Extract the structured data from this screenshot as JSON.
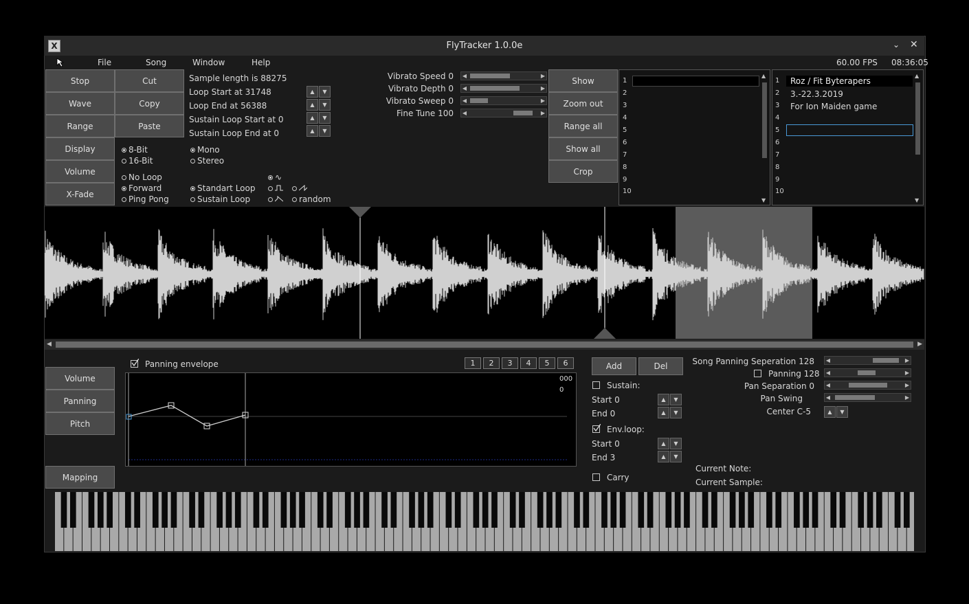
{
  "window": {
    "title": "FlyTracker 1.0.0e"
  },
  "titlebar": {
    "app_icon": "x-app-icon",
    "minimize_icon": "chevron-down-icon",
    "close_icon": "close-icon"
  },
  "menu": {
    "items": [
      "File",
      "Song",
      "Window",
      "Help"
    ],
    "fps": "60.00 FPS",
    "clock": "08:36:05"
  },
  "left_buttons": [
    "Stop",
    "Wave",
    "Range",
    "Display",
    "Volume",
    "X-Fade"
  ],
  "edit_buttons": [
    "Cut",
    "Copy",
    "Paste"
  ],
  "sample_info": {
    "length": "Sample length is 88275",
    "loop_start": "Loop Start at 31748",
    "loop_end": "Loop End at 56388",
    "sustain_start": "Sustain Loop Start at 0",
    "sustain_end": "Sustain Loop End at 0"
  },
  "bits": {
    "options": [
      "8-Bit",
      "16-Bit"
    ],
    "selected": "8-Bit"
  },
  "channels": {
    "options": [
      "Mono",
      "Stereo"
    ],
    "selected": "Mono"
  },
  "loop_mode": {
    "options": [
      "No Loop",
      "Forward",
      "Ping Pong"
    ],
    "selected": "Forward"
  },
  "loop_type": {
    "options": [
      "Standart Loop",
      "Sustain Loop"
    ],
    "selected": "Standart Loop"
  },
  "waveform_options": {
    "random_label": "random"
  },
  "vibrato": {
    "speed_label": "Vibrato Speed 0",
    "speed": 0.0,
    "depth_label": "Vibrato Depth 0",
    "depth": 0.0,
    "sweep_label": "Vibrato Sweep 0",
    "sweep": 0.0,
    "finetune_label": "Fine Tune 100"
  },
  "view_buttons": [
    "Show",
    "Zoom out",
    "Range all",
    "Show all",
    "Crop"
  ],
  "instrument_list": {
    "numbers": [
      "1",
      "2",
      "3",
      "4",
      "5",
      "6",
      "7",
      "8",
      "9",
      "10"
    ]
  },
  "sample_list": {
    "numbers": [
      "1",
      "2",
      "3",
      "4",
      "5",
      "6",
      "7",
      "8",
      "9",
      "10"
    ],
    "entries": [
      "Roz / Fit  Byterapers",
      "3.-22.3.2019",
      "For Ion Maiden game"
    ]
  },
  "envelope": {
    "title": "Panning envelope",
    "tabs": [
      "1",
      "2",
      "3",
      "4",
      "5",
      "6"
    ],
    "readout_top": "000",
    "readout_bottom": "0",
    "tabs_left": [
      "Volume",
      "Panning",
      "Pitch"
    ],
    "mapping": "Mapping",
    "add": "Add",
    "del": "Del",
    "sustain_label": "Sustain:",
    "sustain_start": "Start 0",
    "sustain_end": "End 0",
    "envloop_label": "Env.loop:",
    "envloop_start": "Start 0",
    "envloop_end": "End 3",
    "carry_label": "Carry"
  },
  "panning": {
    "song_sep": "Song Panning Seperation 128",
    "panning": "Panning 128",
    "pan_sep": "Pan Separation 0",
    "pan_swing": "Pan Swing",
    "center": "Center C-5",
    "current_note": "Current Note:",
    "current_sample": "Current Sample:"
  }
}
